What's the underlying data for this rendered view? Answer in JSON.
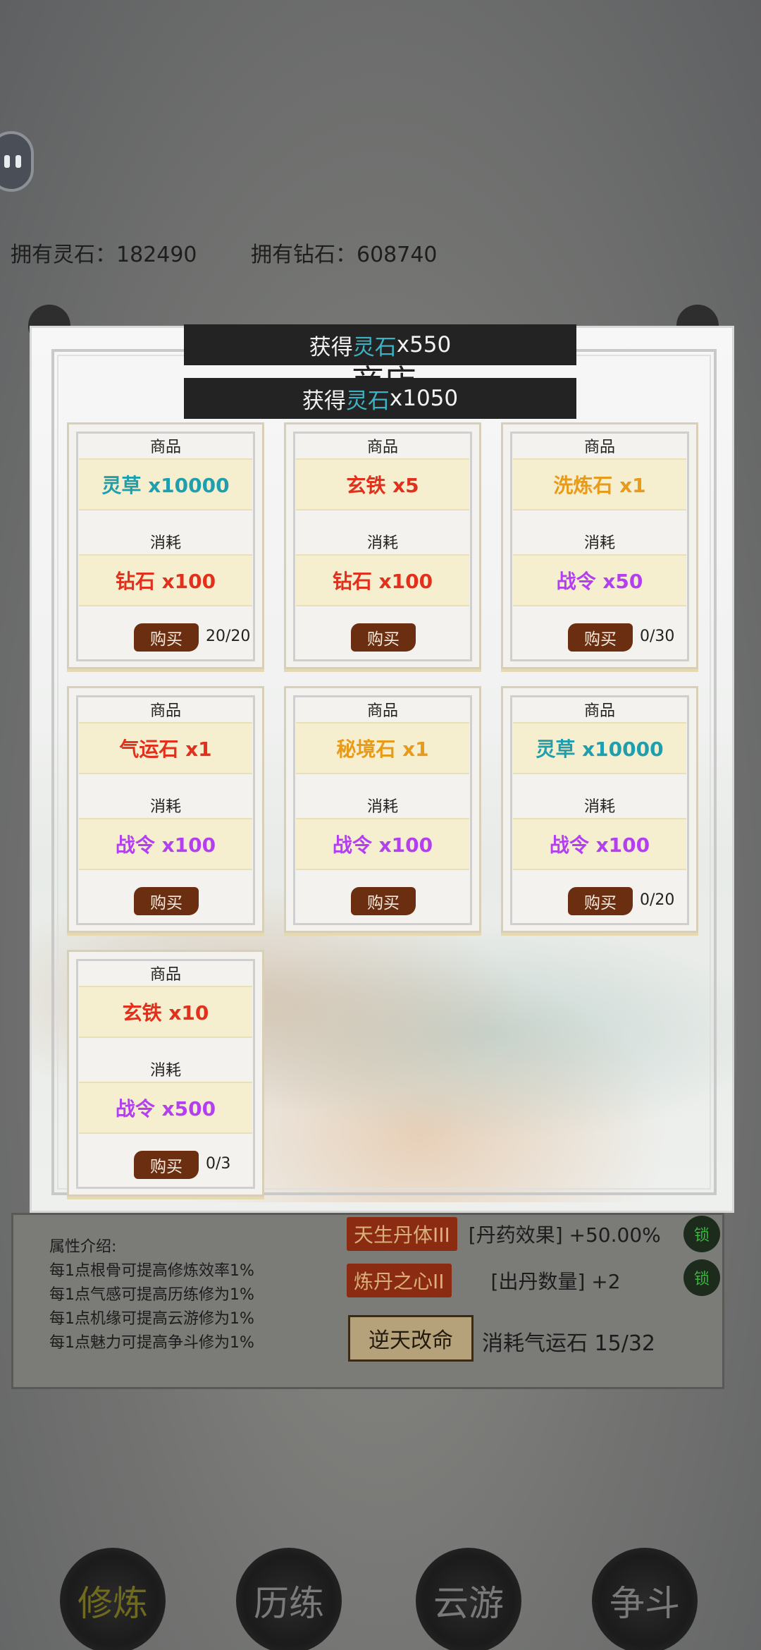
{
  "background": {
    "resources": {
      "lingshi_label": "拥有灵石：182490",
      "zuanshi_label": "拥有钻石：608740"
    },
    "attr_intro": {
      "title": "属性介绍:",
      "lines": [
        "每1点根骨可提高修炼效率1%",
        "每1点气感可提高历练修为1%",
        "每1点机缘可提高云游修为1%",
        "每1点魅力可提高争斗修为1%"
      ]
    },
    "traits": [
      {
        "tag": "天生丹体III",
        "desc": "[丹药效果] +50.00%",
        "lock": "锁"
      },
      {
        "tag": "炼丹之心II",
        "desc": "[出丹数量] +2",
        "lock": "锁"
      }
    ],
    "reverse": {
      "button": "逆天改命",
      "cost": "消耗气运石 15/32"
    },
    "nav": [
      {
        "label": "修炼",
        "active": true
      },
      {
        "label": "历练",
        "active": false
      },
      {
        "label": "云游",
        "active": false
      },
      {
        "label": "争斗",
        "active": false
      }
    ]
  },
  "shop": {
    "title": "商店",
    "toasts": [
      {
        "prefix": "获得 ",
        "item": "灵石",
        "amount": "x550"
      },
      {
        "prefix": "获得 ",
        "item": "灵石",
        "amount": "x1050"
      }
    ],
    "item_label": "商品",
    "cost_label": "消耗",
    "buy_label": "购买",
    "cards": [
      {
        "item": "灵草 x10000",
        "item_color": "#1f9fae",
        "cost": "钻石 x100",
        "cost_color": "#e3301c",
        "count": "20/20"
      },
      {
        "item": "玄铁 x5",
        "item_color": "#e3301c",
        "cost": "钻石 x100",
        "cost_color": "#e3301c",
        "count": ""
      },
      {
        "item": "洗炼石 x1",
        "item_color": "#e89a1a",
        "cost": "战令 x50",
        "cost_color": "#b43ff0",
        "count": "0/30"
      },
      {
        "item": "气运石 x1",
        "item_color": "#e3301c",
        "cost": "战令 x100",
        "cost_color": "#b43ff0",
        "count": ""
      },
      {
        "item": "秘境石 x1",
        "item_color": "#e89a1a",
        "cost": "战令 x100",
        "cost_color": "#b43ff0",
        "count": ""
      },
      {
        "item": "灵草 x10000",
        "item_color": "#1f9fae",
        "cost": "战令 x100",
        "cost_color": "#b43ff0",
        "count": "0/20"
      },
      {
        "item": "玄铁 x10",
        "item_color": "#e3301c",
        "cost": "战令 x500",
        "cost_color": "#b43ff0",
        "count": "0/3"
      }
    ]
  }
}
